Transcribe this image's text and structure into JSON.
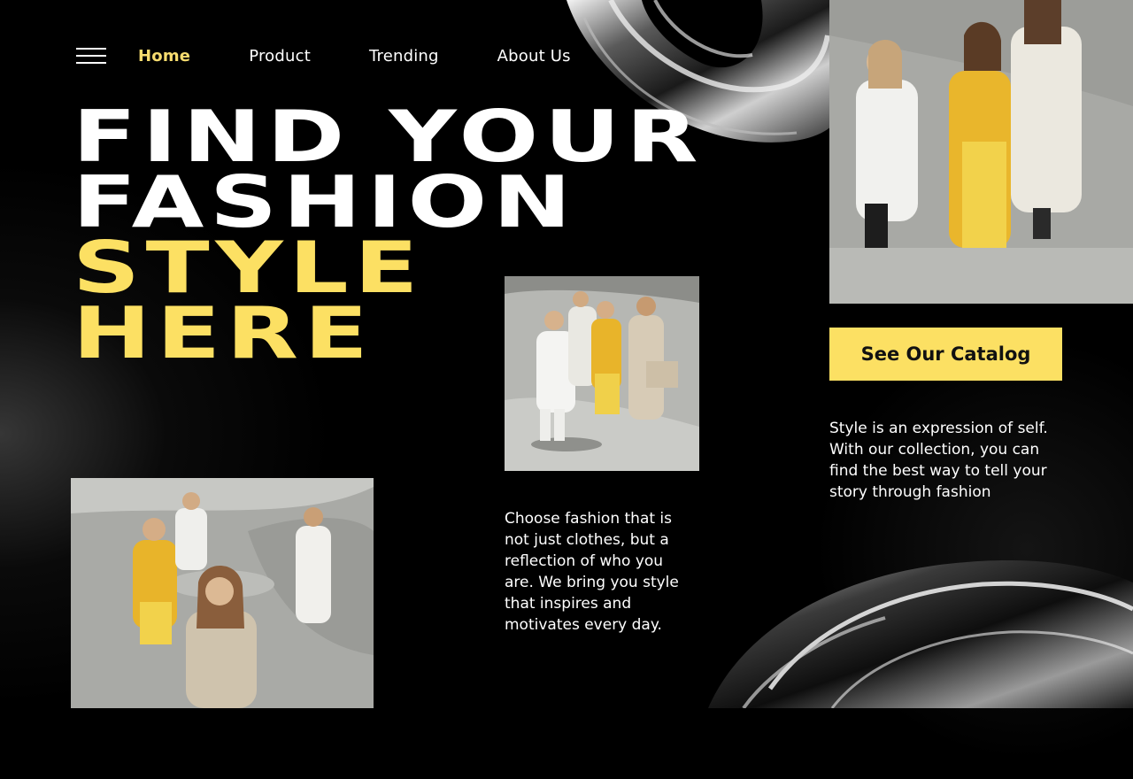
{
  "nav": {
    "menu_icon": "hamburger-menu-icon",
    "items": [
      {
        "label": "Home",
        "active": true
      },
      {
        "label": "Product",
        "active": false
      },
      {
        "label": "Trending",
        "active": false
      },
      {
        "label": "About Us",
        "active": false
      }
    ]
  },
  "hero": {
    "line1": "FIND YOUR",
    "line2": "FASHION",
    "line3": "STYLE",
    "line4": "HERE"
  },
  "cta": {
    "label": "See Our Catalog"
  },
  "copy": {
    "right": "Style is an expression of self. With our collection, you can find the best way to tell your story through fashion",
    "middle": "Choose fashion that is not just clothes, but a reflection of who you are. We bring you style that inspires and motivates every day."
  },
  "colors": {
    "accent": "#fce063",
    "background": "#000000",
    "text": "#ffffff"
  }
}
